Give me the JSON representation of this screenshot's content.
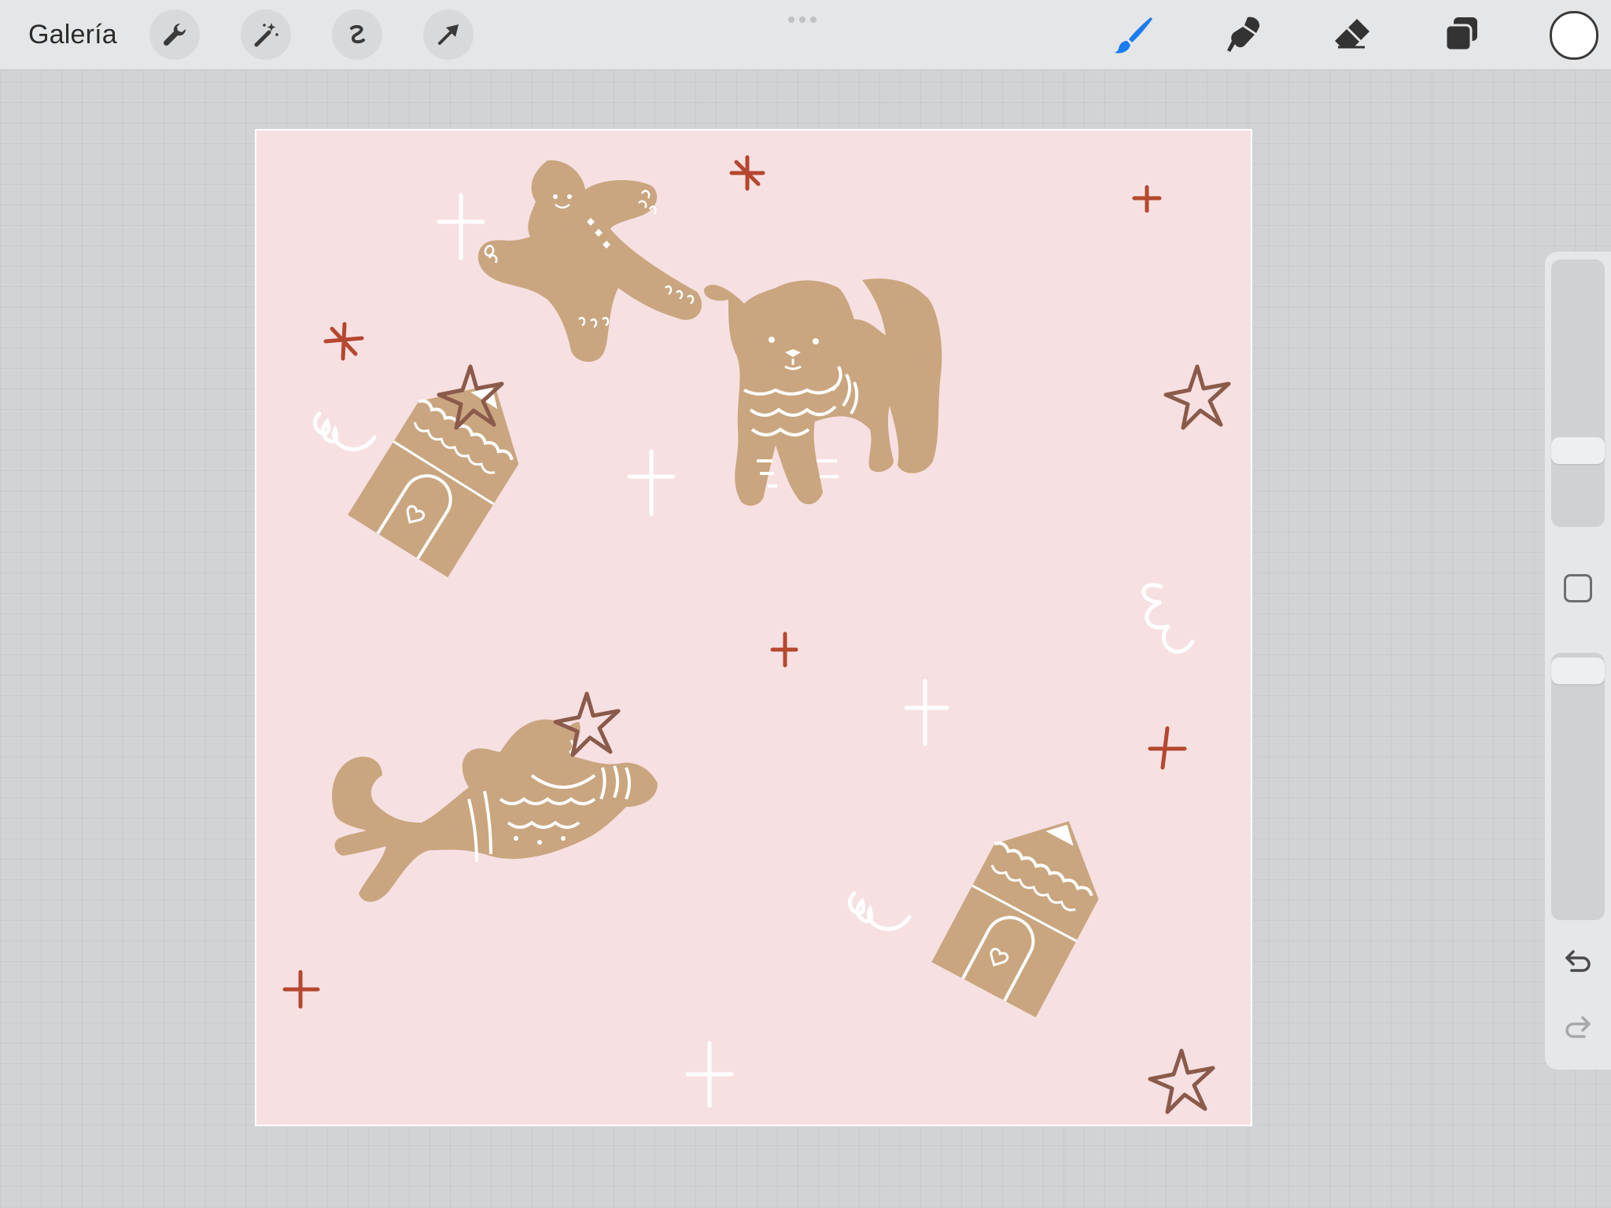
{
  "app": {
    "gallery_label": "Galería"
  },
  "toolbar_left": {
    "tools": [
      {
        "icon": "wrench-icon",
        "action": "actions"
      },
      {
        "icon": "magic-wand-icon",
        "action": "adjustments"
      },
      {
        "icon": "selection-icon",
        "action": "selection"
      },
      {
        "icon": "transform-arrow-icon",
        "action": "transform"
      }
    ]
  },
  "toolbar_right": {
    "tools": [
      {
        "icon": "brush-icon",
        "action": "paint",
        "active": true,
        "color": "#1a7cf0"
      },
      {
        "icon": "smudge-icon",
        "action": "smudge",
        "active": false,
        "color": "#333333"
      },
      {
        "icon": "eraser-icon",
        "action": "erase",
        "active": false,
        "color": "#333333"
      },
      {
        "icon": "layers-icon",
        "action": "layers",
        "active": false,
        "color": "#333333"
      }
    ],
    "current_color": "#ffffff"
  },
  "canvas": {
    "background_color": "#f7e0e2",
    "cookie_color": "#c9a67f",
    "icing_color": "#ffffff",
    "star_color": "#8a5a4a",
    "sparkle_red": "#b5472e"
  },
  "sidebar": {
    "brush_size_level": 0.72,
    "opacity_level": 0.0,
    "icons": [
      "square-modify-icon",
      "undo-icon",
      "redo-icon"
    ]
  }
}
